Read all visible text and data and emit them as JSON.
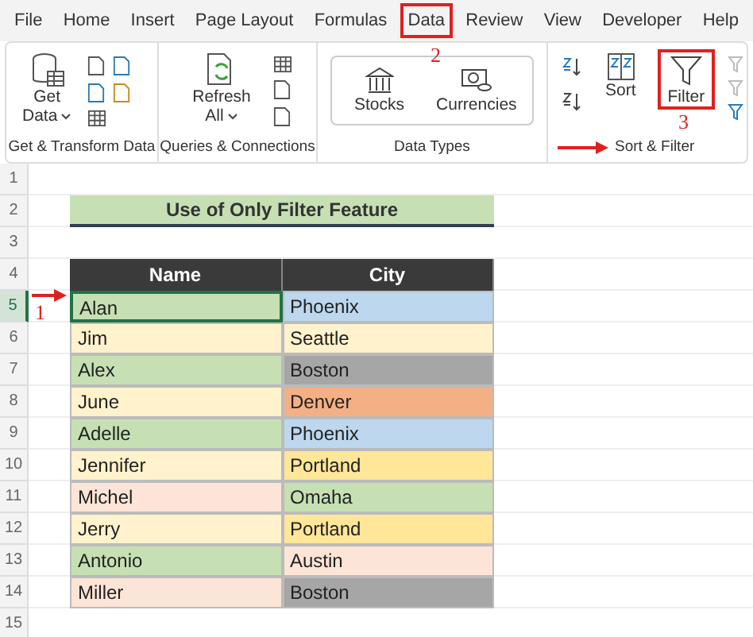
{
  "tabs": [
    {
      "label": "File",
      "highlighted": false
    },
    {
      "label": "Home",
      "highlighted": false
    },
    {
      "label": "Insert",
      "highlighted": false
    },
    {
      "label": "Page Layout",
      "highlighted": false
    },
    {
      "label": "Formulas",
      "highlighted": false
    },
    {
      "label": "Data",
      "highlighted": true
    },
    {
      "label": "Review",
      "highlighted": false
    },
    {
      "label": "View",
      "highlighted": false
    },
    {
      "label": "Developer",
      "highlighted": false
    },
    {
      "label": "Help",
      "highlighted": false
    }
  ],
  "ribbon": {
    "groups": [
      {
        "label": "Get & Transform Data",
        "buttons": [
          {
            "lines": [
              "Get",
              "Data"
            ],
            "dropdown": true
          }
        ]
      },
      {
        "label": "Queries & Connections",
        "buttons": [
          {
            "lines": [
              "Refresh",
              "All"
            ],
            "dropdown": true
          }
        ]
      },
      {
        "label": "Data Types",
        "buttons": [
          {
            "lines": [
              "Stocks"
            ]
          },
          {
            "lines": [
              "Currencies"
            ]
          }
        ]
      },
      {
        "label": "Sort & Filter",
        "buttons": [
          {
            "lines": [
              "Sort"
            ],
            "highlighted": false
          },
          {
            "lines": [
              "Filter"
            ],
            "highlighted": true
          }
        ]
      }
    ]
  },
  "callouts": [
    {
      "label": "2"
    },
    {
      "label": "3"
    },
    {
      "label": "1"
    }
  ],
  "sheet": {
    "row_numbers": [
      "1",
      "2",
      "3",
      "4",
      "5",
      "6",
      "7",
      "8",
      "9",
      "10",
      "11",
      "12",
      "13",
      "14",
      "15"
    ],
    "title": "Use of Only Filter Feature",
    "headers": [
      "Name",
      "City"
    ],
    "rows": [
      {
        "selected": true,
        "cells": [
          {
            "text": "Alan",
            "color": "#c6e0b4"
          },
          {
            "text": "Phoenix",
            "color": "#bdd7ee"
          }
        ]
      },
      {
        "selected": false,
        "cells": [
          {
            "text": "Jim",
            "color": "#fff2cc"
          },
          {
            "text": "Seattle",
            "color": "#fff2cc"
          }
        ]
      },
      {
        "selected": false,
        "cells": [
          {
            "text": "Alex",
            "color": "#c6e0b4"
          },
          {
            "text": "Boston",
            "color": "#a6a6a6"
          }
        ]
      },
      {
        "selected": false,
        "cells": [
          {
            "text": "June",
            "color": "#fff2cc"
          },
          {
            "text": "Denver",
            "color": "#f4b084"
          }
        ]
      },
      {
        "selected": false,
        "cells": [
          {
            "text": "Adelle",
            "color": "#c6e0b4"
          },
          {
            "text": "Phoenix",
            "color": "#bdd7ee"
          }
        ]
      },
      {
        "selected": false,
        "cells": [
          {
            "text": "Jennifer",
            "color": "#fff2cc"
          },
          {
            "text": "Portland",
            "color": "#ffe699"
          }
        ]
      },
      {
        "selected": false,
        "cells": [
          {
            "text": "Michel",
            "color": "#fce4d6"
          },
          {
            "text": "Omaha",
            "color": "#c6e0b4"
          }
        ]
      },
      {
        "selected": false,
        "cells": [
          {
            "text": "Jerry",
            "color": "#fff2cc"
          },
          {
            "text": "Portland",
            "color": "#ffe699"
          }
        ]
      },
      {
        "selected": false,
        "cells": [
          {
            "text": "Antonio",
            "color": "#c6e0b4"
          },
          {
            "text": "Austin",
            "color": "#fce4d6"
          }
        ]
      },
      {
        "selected": false,
        "cells": [
          {
            "text": "Miller",
            "color": "#fce4d6"
          },
          {
            "text": "Boston",
            "color": "#a6a6a6"
          }
        ]
      }
    ]
  }
}
